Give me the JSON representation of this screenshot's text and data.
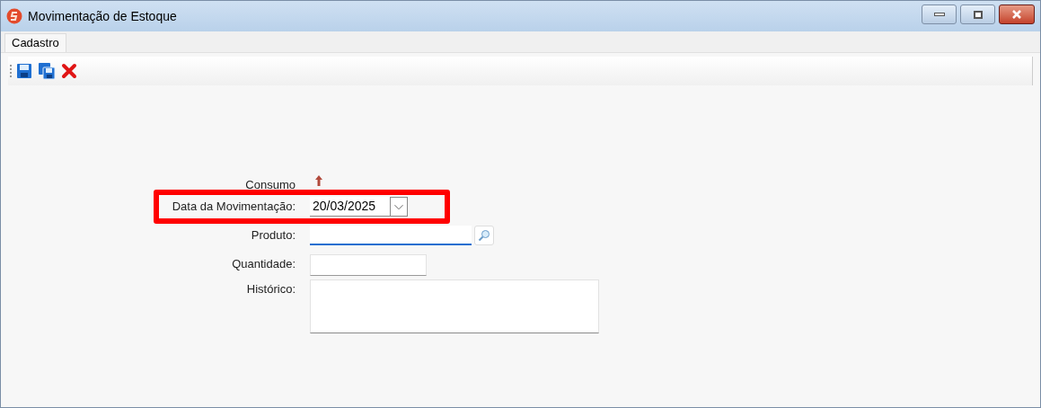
{
  "window": {
    "title": "Movimentação de Estoque"
  },
  "tabs": [
    {
      "label": "Cadastro",
      "selected": true
    }
  ],
  "toolbar": [
    {
      "kind": "save"
    },
    {
      "kind": "save-all"
    },
    {
      "kind": "delete"
    }
  ],
  "form": [
    {
      "kind": "indicator",
      "label": "Consumo",
      "highlighted": false
    },
    {
      "kind": "date",
      "label": "Data da Movimentação:",
      "value": "20/03/2025",
      "highlighted": true
    },
    {
      "kind": "lookup",
      "label": "Produto:",
      "highlighted": false
    },
    {
      "kind": "text",
      "label": "Quantidade:",
      "highlighted": false
    },
    {
      "kind": "memo",
      "label": "Histórico:",
      "highlighted": false
    }
  ]
}
